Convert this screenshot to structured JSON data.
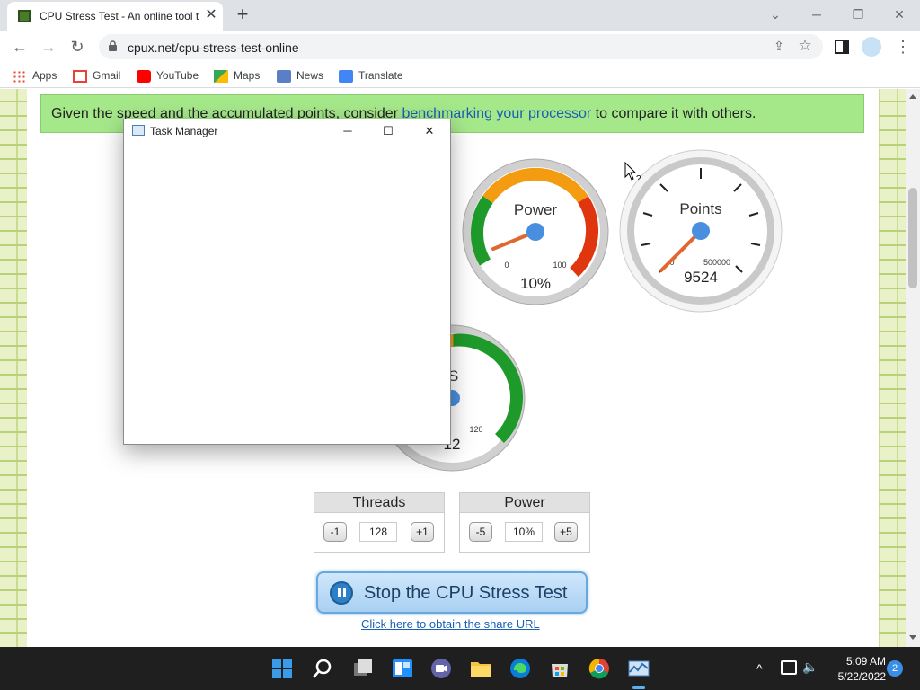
{
  "browser": {
    "tab_title": "CPU Stress Test - An online tool t",
    "url": "cpux.net/cpu-stress-test-online",
    "bookmarks": [
      "Apps",
      "Gmail",
      "YouTube",
      "Maps",
      "News",
      "Translate"
    ]
  },
  "page": {
    "notice": {
      "before": "Given the speed and the accumulated points, consider ",
      "link": "benchmarking your processor",
      "after": " to compare it with others."
    },
    "gauges": {
      "power": {
        "label": "Power",
        "min_label": "0",
        "max_label": "100",
        "readout": "10%",
        "value_fraction": 0.1
      },
      "points": {
        "label": "Points",
        "min_label": "0",
        "max_label": "500000",
        "readout": "9524",
        "value_fraction": 0.019
      },
      "fps": {
        "label_partial": "PS",
        "max_label": "120",
        "readout_partial": "12"
      }
    },
    "threads": {
      "title": "Threads",
      "dec": "-1",
      "value": "128",
      "inc": "+1"
    },
    "power": {
      "title": "Power",
      "dec": "-5",
      "value": "10%",
      "inc": "+5"
    },
    "stop_button": "Stop the CPU Stress Test",
    "share_link": "Click here to obtain the share URL"
  },
  "task_manager": {
    "title": "Task Manager"
  },
  "taskbar": {
    "time": "5:09 AM",
    "date": "5/22/2022",
    "notifications": "2"
  },
  "colors": {
    "notice_bg": "#a5e88a",
    "link": "#1a5fb4",
    "accent": "#2f7fc6"
  }
}
